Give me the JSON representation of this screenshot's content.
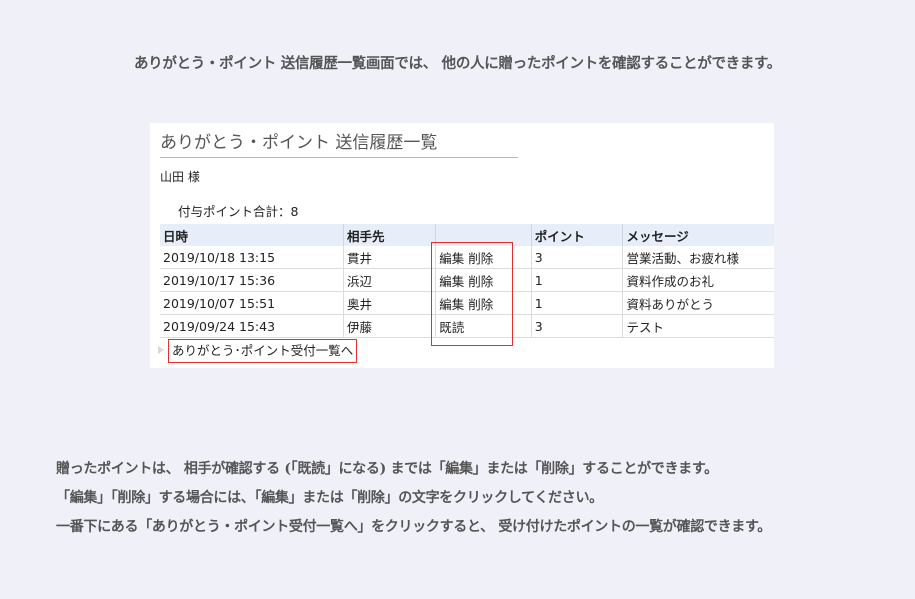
{
  "intro_text": "ありがとう・ポイント 送信履歴一覧画面では、 他の人に贈ったポイントを確認することができます。",
  "panel": {
    "title": "ありがとう・ポイント 送信履歴一覧",
    "user": "山田 様",
    "total_label": "付与ポイント合計：8",
    "columns": [
      "日時",
      "相手先",
      "",
      "ポイント",
      "メッセージ"
    ],
    "rows": [
      {
        "datetime": "2019/10/18 13:15",
        "recipient": "貫井",
        "actions": [
          "編集",
          "削除"
        ],
        "points": "3",
        "message": "営業活動、お疲れ様"
      },
      {
        "datetime": "2019/10/17 15:36",
        "recipient": "浜辺",
        "actions": [
          "編集",
          "削除"
        ],
        "points": "1",
        "message": "資料作成のお礼"
      },
      {
        "datetime": "2019/10/07 15:51",
        "recipient": "奥井",
        "actions": [
          "編集",
          "削除"
        ],
        "points": "1",
        "message": "資料ありがとう"
      },
      {
        "datetime": "2019/09/24 15:43",
        "recipient": "伊藤",
        "actions": [
          "既読"
        ],
        "points": "3",
        "message": "テスト"
      }
    ],
    "receive_link": "ありがとう･ポイント受付一覧へ"
  },
  "notes": [
    "贈ったポイントは、 相手が確認する (「既読」になる) までは「編集」または「削除」することができます。",
    "「編集」「削除」する場合には、「編集」または「削除」の文字をクリックしてください。",
    "一番下にある「ありがとう・ポイント受付一覧へ」をクリックすると、 受け付けたポイントの一覧が確認できます。"
  ],
  "colors": {
    "highlight": "#e23030",
    "header_bg": "#e7eef9"
  }
}
